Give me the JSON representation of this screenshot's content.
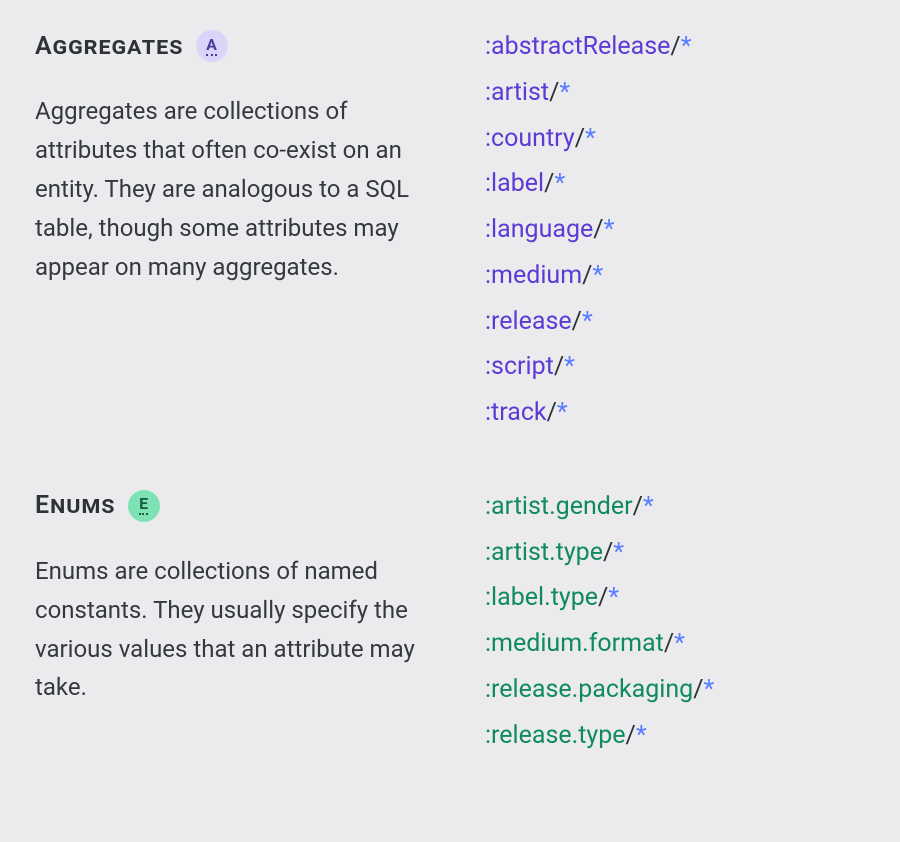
{
  "sections": [
    {
      "id": "aggregates",
      "title": "Aggregates",
      "badge_letter": "A",
      "badge_class": "badge-purple",
      "name_class": "name-purple",
      "description": "Aggregates are collections of attributes that often co-exist on an entity. They are analogous to a SQL table, though some attributes may appear on many aggregates.",
      "items": [
        ":abstractRelease",
        ":artist",
        ":country",
        ":label",
        ":language",
        ":medium",
        ":release",
        ":script",
        ":track"
      ]
    },
    {
      "id": "enums",
      "title": "Enums",
      "badge_letter": "E",
      "badge_class": "badge-green",
      "name_class": "name-green",
      "description": "Enums are collections of named constants. They usually specify the various values that an attribute may take.",
      "items": [
        ":artist.gender",
        ":artist.type",
        ":label.type",
        ":medium.format",
        ":release.packaging",
        ":release.type"
      ]
    }
  ],
  "glyphs": {
    "slash": "/",
    "star": "*"
  }
}
